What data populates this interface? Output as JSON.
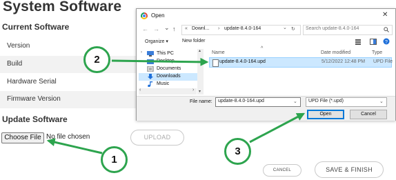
{
  "page": {
    "title": "System Software",
    "current_software_heading": "Current Software",
    "rows": [
      "Version",
      "Build",
      "Hardware Serial",
      "Firmware Version"
    ],
    "update_software_heading": "Update Software",
    "choose_file_label": "Choose File",
    "no_file_text": "No file chosen",
    "upload_label": "UPLOAD",
    "cancel_label": "CANCEL",
    "save_finish_label": "SAVE & FINISH"
  },
  "dialog": {
    "title": "Open",
    "close_glyph": "✕",
    "nav": {
      "back": "←",
      "forward": "→",
      "recent": "⌄",
      "up": "↑"
    },
    "address": {
      "prefix": "«",
      "part1": "Downl...",
      "sep": "›",
      "part2": "update-8.4.0-164",
      "dropdown": "⌄",
      "refresh": "↻"
    },
    "search_placeholder": "Search update-8.4.0-164",
    "toolbar": {
      "organize": "Organize ▾",
      "new_folder": "New folder"
    },
    "tree": [
      {
        "label": "This PC",
        "icon": "pc-icon"
      },
      {
        "label": "Desktop",
        "icon": "desktop-folder-icon"
      },
      {
        "label": "Documents",
        "icon": "documents-icon"
      },
      {
        "label": "Downloads",
        "icon": "downloads-icon",
        "selected": true
      },
      {
        "label": "Music",
        "icon": "music-icon"
      }
    ],
    "columns": {
      "name": "Name",
      "date": "Date modified",
      "type": "Type"
    },
    "files": [
      {
        "name": "update-8.4.0-164.upd",
        "date": "5/12/2022 12:48 PM",
        "type": "UPD File"
      }
    ],
    "file_name_label": "File name:",
    "file_name_value": "update-8.4.0-164.upd",
    "file_type_value": "UPD File (*.upd)",
    "open_label": "Open",
    "cancel_label": "Cancel"
  },
  "annotations": {
    "step1": "1",
    "step2": "2",
    "step3": "3",
    "color": "#2da44e"
  }
}
